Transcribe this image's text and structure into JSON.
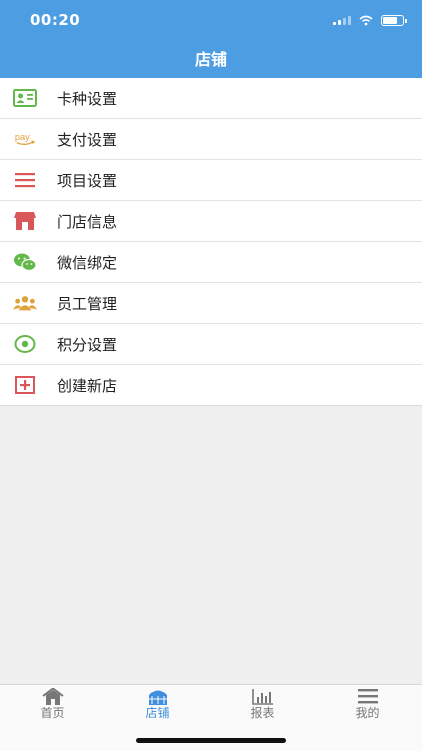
{
  "status_bar": {
    "time": "00:20"
  },
  "header": {
    "title": "店铺"
  },
  "menu": {
    "items": [
      {
        "label": "卡种设置",
        "icon": "id-card-icon",
        "icon_color": "#63b84a"
      },
      {
        "label": "支付设置",
        "icon": "pay-icon",
        "icon_color": "#e0a23c",
        "icon_text": "pay"
      },
      {
        "label": "项目设置",
        "icon": "list-icon",
        "icon_color": "#d9575a"
      },
      {
        "label": "门店信息",
        "icon": "store-icon",
        "icon_color": "#d9575a"
      },
      {
        "label": "微信绑定",
        "icon": "wechat-icon",
        "icon_color": "#63b84a"
      },
      {
        "label": "员工管理",
        "icon": "group-icon",
        "icon_color": "#e0a23c"
      },
      {
        "label": "积分设置",
        "icon": "eye-icon",
        "icon_color": "#63b84a"
      },
      {
        "label": "创建新店",
        "icon": "plus-square-icon",
        "icon_color": "#d9575a"
      }
    ]
  },
  "tabbar": {
    "tabs": [
      {
        "label": "首页",
        "icon": "home-icon",
        "active": false
      },
      {
        "label": "店铺",
        "icon": "shop-icon",
        "active": true
      },
      {
        "label": "报表",
        "icon": "bar-chart-icon",
        "active": false
      },
      {
        "label": "我的",
        "icon": "menu-icon",
        "active": false
      }
    ]
  },
  "colors": {
    "header_bg": "#4d9de3",
    "active_tab": "#3f8fde",
    "inactive_tab": "#777777"
  }
}
